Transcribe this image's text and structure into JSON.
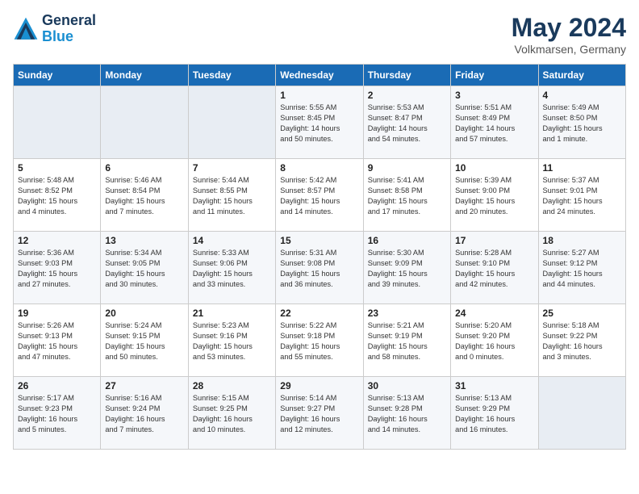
{
  "header": {
    "logo_line1": "General",
    "logo_line2": "Blue",
    "month_year": "May 2024",
    "location": "Volkmarsen, Germany"
  },
  "days_of_week": [
    "Sunday",
    "Monday",
    "Tuesday",
    "Wednesday",
    "Thursday",
    "Friday",
    "Saturday"
  ],
  "weeks": [
    [
      {
        "day": "",
        "content": ""
      },
      {
        "day": "",
        "content": ""
      },
      {
        "day": "",
        "content": ""
      },
      {
        "day": "1",
        "content": "Sunrise: 5:55 AM\nSunset: 8:45 PM\nDaylight: 14 hours\nand 50 minutes."
      },
      {
        "day": "2",
        "content": "Sunrise: 5:53 AM\nSunset: 8:47 PM\nDaylight: 14 hours\nand 54 minutes."
      },
      {
        "day": "3",
        "content": "Sunrise: 5:51 AM\nSunset: 8:49 PM\nDaylight: 14 hours\nand 57 minutes."
      },
      {
        "day": "4",
        "content": "Sunrise: 5:49 AM\nSunset: 8:50 PM\nDaylight: 15 hours\nand 1 minute."
      }
    ],
    [
      {
        "day": "5",
        "content": "Sunrise: 5:48 AM\nSunset: 8:52 PM\nDaylight: 15 hours\nand 4 minutes."
      },
      {
        "day": "6",
        "content": "Sunrise: 5:46 AM\nSunset: 8:54 PM\nDaylight: 15 hours\nand 7 minutes."
      },
      {
        "day": "7",
        "content": "Sunrise: 5:44 AM\nSunset: 8:55 PM\nDaylight: 15 hours\nand 11 minutes."
      },
      {
        "day": "8",
        "content": "Sunrise: 5:42 AM\nSunset: 8:57 PM\nDaylight: 15 hours\nand 14 minutes."
      },
      {
        "day": "9",
        "content": "Sunrise: 5:41 AM\nSunset: 8:58 PM\nDaylight: 15 hours\nand 17 minutes."
      },
      {
        "day": "10",
        "content": "Sunrise: 5:39 AM\nSunset: 9:00 PM\nDaylight: 15 hours\nand 20 minutes."
      },
      {
        "day": "11",
        "content": "Sunrise: 5:37 AM\nSunset: 9:01 PM\nDaylight: 15 hours\nand 24 minutes."
      }
    ],
    [
      {
        "day": "12",
        "content": "Sunrise: 5:36 AM\nSunset: 9:03 PM\nDaylight: 15 hours\nand 27 minutes."
      },
      {
        "day": "13",
        "content": "Sunrise: 5:34 AM\nSunset: 9:05 PM\nDaylight: 15 hours\nand 30 minutes."
      },
      {
        "day": "14",
        "content": "Sunrise: 5:33 AM\nSunset: 9:06 PM\nDaylight: 15 hours\nand 33 minutes."
      },
      {
        "day": "15",
        "content": "Sunrise: 5:31 AM\nSunset: 9:08 PM\nDaylight: 15 hours\nand 36 minutes."
      },
      {
        "day": "16",
        "content": "Sunrise: 5:30 AM\nSunset: 9:09 PM\nDaylight: 15 hours\nand 39 minutes."
      },
      {
        "day": "17",
        "content": "Sunrise: 5:28 AM\nSunset: 9:10 PM\nDaylight: 15 hours\nand 42 minutes."
      },
      {
        "day": "18",
        "content": "Sunrise: 5:27 AM\nSunset: 9:12 PM\nDaylight: 15 hours\nand 44 minutes."
      }
    ],
    [
      {
        "day": "19",
        "content": "Sunrise: 5:26 AM\nSunset: 9:13 PM\nDaylight: 15 hours\nand 47 minutes."
      },
      {
        "day": "20",
        "content": "Sunrise: 5:24 AM\nSunset: 9:15 PM\nDaylight: 15 hours\nand 50 minutes."
      },
      {
        "day": "21",
        "content": "Sunrise: 5:23 AM\nSunset: 9:16 PM\nDaylight: 15 hours\nand 53 minutes."
      },
      {
        "day": "22",
        "content": "Sunrise: 5:22 AM\nSunset: 9:18 PM\nDaylight: 15 hours\nand 55 minutes."
      },
      {
        "day": "23",
        "content": "Sunrise: 5:21 AM\nSunset: 9:19 PM\nDaylight: 15 hours\nand 58 minutes."
      },
      {
        "day": "24",
        "content": "Sunrise: 5:20 AM\nSunset: 9:20 PM\nDaylight: 16 hours\nand 0 minutes."
      },
      {
        "day": "25",
        "content": "Sunrise: 5:18 AM\nSunset: 9:22 PM\nDaylight: 16 hours\nand 3 minutes."
      }
    ],
    [
      {
        "day": "26",
        "content": "Sunrise: 5:17 AM\nSunset: 9:23 PM\nDaylight: 16 hours\nand 5 minutes."
      },
      {
        "day": "27",
        "content": "Sunrise: 5:16 AM\nSunset: 9:24 PM\nDaylight: 16 hours\nand 7 minutes."
      },
      {
        "day": "28",
        "content": "Sunrise: 5:15 AM\nSunset: 9:25 PM\nDaylight: 16 hours\nand 10 minutes."
      },
      {
        "day": "29",
        "content": "Sunrise: 5:14 AM\nSunset: 9:27 PM\nDaylight: 16 hours\nand 12 minutes."
      },
      {
        "day": "30",
        "content": "Sunrise: 5:13 AM\nSunset: 9:28 PM\nDaylight: 16 hours\nand 14 minutes."
      },
      {
        "day": "31",
        "content": "Sunrise: 5:13 AM\nSunset: 9:29 PM\nDaylight: 16 hours\nand 16 minutes."
      },
      {
        "day": "",
        "content": ""
      }
    ]
  ]
}
